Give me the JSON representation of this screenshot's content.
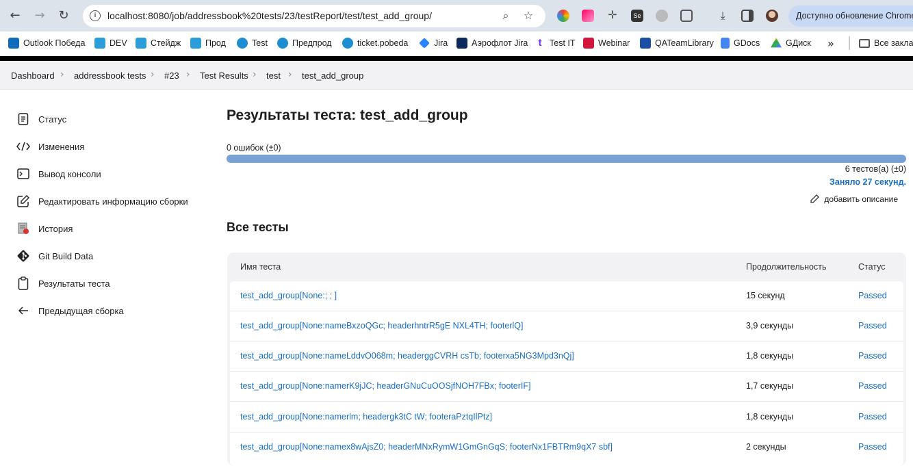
{
  "browser": {
    "url": "localhost:8080/job/addressbook%20tests/23/testReport/test/test_add_group/",
    "update_label": "Доступно обновление Chrome"
  },
  "bookmarks": [
    {
      "label": "Outlook Победа",
      "color": "#0f6cbd"
    },
    {
      "label": "DEV",
      "color": "#2d9cdb"
    },
    {
      "label": "Стейдж",
      "color": "#2d9cdb"
    },
    {
      "label": "Прод",
      "color": "#2d9cdb"
    },
    {
      "label": "Test",
      "color": "#1c8ed1"
    },
    {
      "label": "Предпрод",
      "color": "#1c8ed1"
    },
    {
      "label": "ticket.pobeda",
      "color": "#1c8ed1"
    },
    {
      "label": "Jira",
      "color": "#2684ff"
    },
    {
      "label": "Аэрофлот Jira",
      "color": "#0b2a5b"
    },
    {
      "label": "Test IT",
      "color": "#7b2ff7"
    },
    {
      "label": "Webinar",
      "color": "#d1153b"
    },
    {
      "label": "QATeamLibrary",
      "color": "#1a4fa3"
    },
    {
      "label": "GDocs",
      "color": "#4285f4"
    },
    {
      "label": "GДиск",
      "color": "#34a853"
    }
  ],
  "bookmarks_more_label": "Все заклад",
  "breadcrumb": [
    "Dashboard",
    "addressbook tests",
    "#23",
    "Test Results",
    "test",
    "test_add_group"
  ],
  "sidebar": [
    {
      "label": "Статус",
      "icon": "document-icon"
    },
    {
      "label": "Изменения",
      "icon": "code-icon"
    },
    {
      "label": "Вывод консоли",
      "icon": "terminal-icon"
    },
    {
      "label": "Редактировать информацию сборки",
      "icon": "edit-icon"
    },
    {
      "label": "История",
      "icon": "history-icon"
    },
    {
      "label": "Git Build Data",
      "icon": "git-icon"
    },
    {
      "label": "Результаты теста",
      "icon": "clipboard-icon"
    },
    {
      "label": "Предыдущая сборка",
      "icon": "arrow-left-icon"
    }
  ],
  "main": {
    "title": "Результаты теста: test_add_group",
    "failures": "0 ошибок (±0)",
    "tests_count": "6 тестов(а) (±0)",
    "took": "Заняло 27 секунд.",
    "add_description": "добавить описание",
    "all_tests_heading": "Все тесты",
    "pass_ratio": 1.0,
    "progress_color": "#7aa1d4"
  },
  "table": {
    "headers": {
      "name": "Имя теста",
      "duration": "Продолжительность",
      "status": "Статус"
    },
    "rows": [
      {
        "name": "test_add_group[None:; ; ]",
        "duration": "15 секунд",
        "status": "Passed"
      },
      {
        "name": "test_add_group[None:nameBxzoQGc; headerhntrR5gE NXL4TH; footerlQ]",
        "duration": "3,9 секунды",
        "status": "Passed"
      },
      {
        "name": "test_add_group[None:nameLddvO068m; headerggCVRH csTb; footerxa5NG3Mpd3nQj]",
        "duration": "1,8 секунды",
        "status": "Passed"
      },
      {
        "name": "test_add_group[None:namerK9jJC; headerGNuCuOOSjfNOH7FBx; footerIF]",
        "duration": "1,7 секунды",
        "status": "Passed"
      },
      {
        "name": "test_add_group[None:namerlm; headergk3tC tW; footeraPztqIlPtz]",
        "duration": "1,8 секунды",
        "status": "Passed"
      },
      {
        "name": "test_add_group[None:namex8wAjsZ0; headerMNxRymW1GmGnGqS; footerNx1FBTRm9qX7 sbf]",
        "duration": "2 секунды",
        "status": "Passed"
      }
    ]
  }
}
